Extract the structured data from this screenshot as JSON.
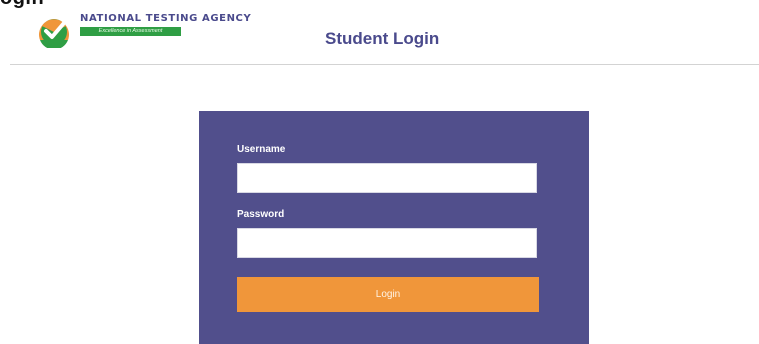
{
  "top_crop_text": "ogin",
  "header": {
    "brand_name": "NATIONAL TESTING AGENCY",
    "brand_tagline": "Excellence in Assessment",
    "page_title": "Student Login"
  },
  "login_form": {
    "username_label": "Username",
    "username_value": "",
    "password_label": "Password",
    "password_value": "",
    "login_button_label": "Login"
  },
  "colors": {
    "panel": "#514f8c",
    "accent_button": "#f0963a",
    "title": "#4a4a8c",
    "tagline_bar": "#2f9e44"
  },
  "icons": {
    "logo": "nta-checkmark-logo-icon"
  }
}
